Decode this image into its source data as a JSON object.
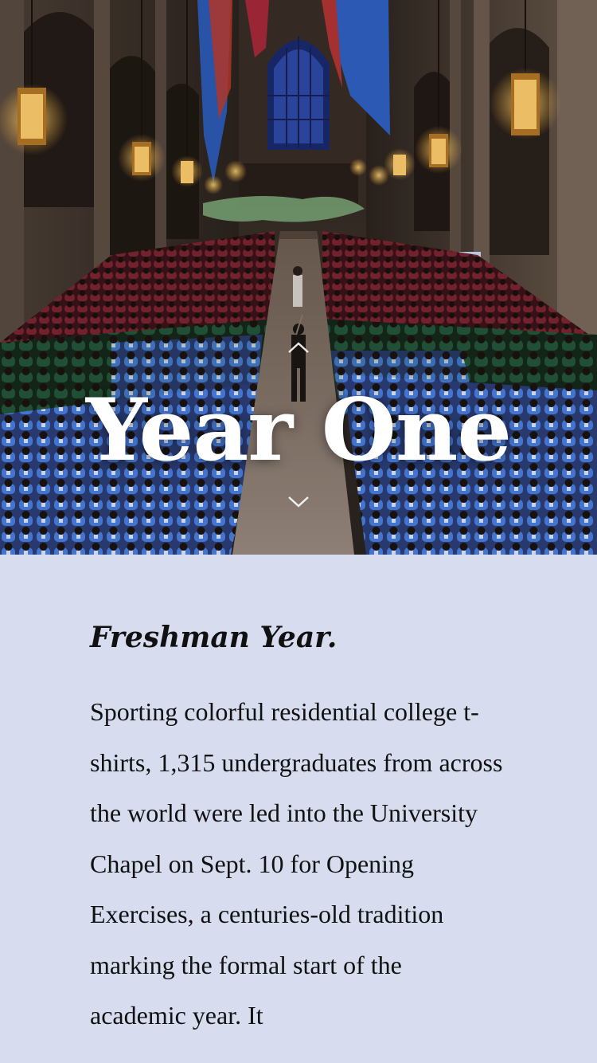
{
  "hero": {
    "title": "Year One",
    "scroll_up_icon": "chevron-up-icon",
    "scroll_down_icon": "chevron-down-icon"
  },
  "article": {
    "heading": "Freshman Year.",
    "body": "Sporting colorful residential college t-shirts, 1,315 undergraduates from across the world were led into the University Chapel on Sept. 10 for Opening Exercises, a centuries-old tradition marking the formal start of the academic year. It"
  },
  "colors": {
    "content_background": "#d7ddef",
    "text": "#111111",
    "hero_title": "#ffffff",
    "shirt_blue": "#3f73d6",
    "shirt_green": "#1f4a2e",
    "shirt_maroon": "#6e1f2a"
  }
}
